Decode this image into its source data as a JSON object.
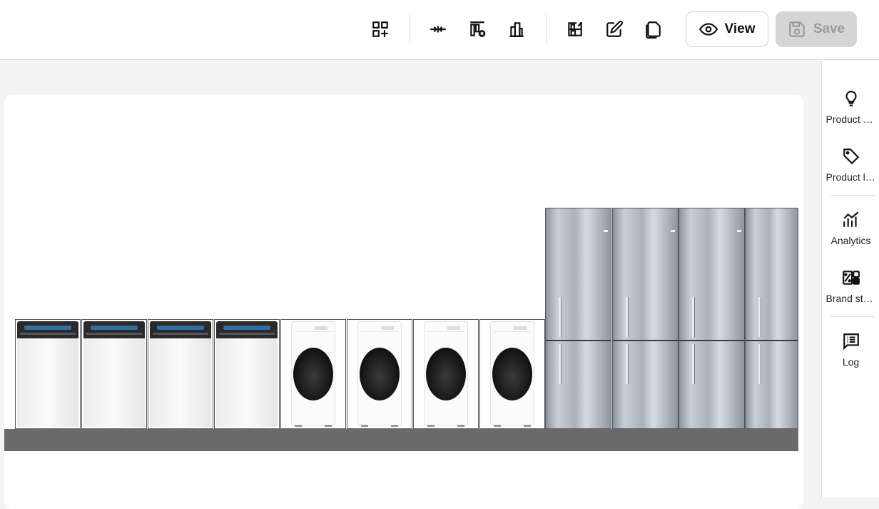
{
  "toolbar": {
    "icons": [
      {
        "name": "add-widget-icon"
      },
      {
        "name": "compress-icon"
      },
      {
        "name": "remove-shelf-icon"
      },
      {
        "name": "fixture-icon"
      },
      {
        "name": "planogram-icon"
      },
      {
        "name": "edit-icon"
      },
      {
        "name": "copy-icon"
      }
    ],
    "view_label": "View",
    "save_label": "Save"
  },
  "canvas": {
    "products": [
      {
        "type": "dishwasher",
        "count": 4
      },
      {
        "type": "washing-machine",
        "count": 4
      },
      {
        "type": "fridge",
        "count": 4
      }
    ]
  },
  "right_panel": {
    "items": [
      {
        "label": "Product highlights",
        "icon": "lightbulb-icon"
      },
      {
        "label": "Product labels",
        "icon": "tag-icon"
      },
      {
        "label": "Analytics",
        "icon": "analytics-icon"
      },
      {
        "label": "Brand statistics",
        "icon": "brand-stats-icon"
      },
      {
        "label": "Log",
        "icon": "log-icon"
      }
    ]
  },
  "colors": {
    "save_disabled_bg": "#d5d5d5",
    "shelf": "#6a6a6a",
    "background": "#f4f4f4"
  }
}
